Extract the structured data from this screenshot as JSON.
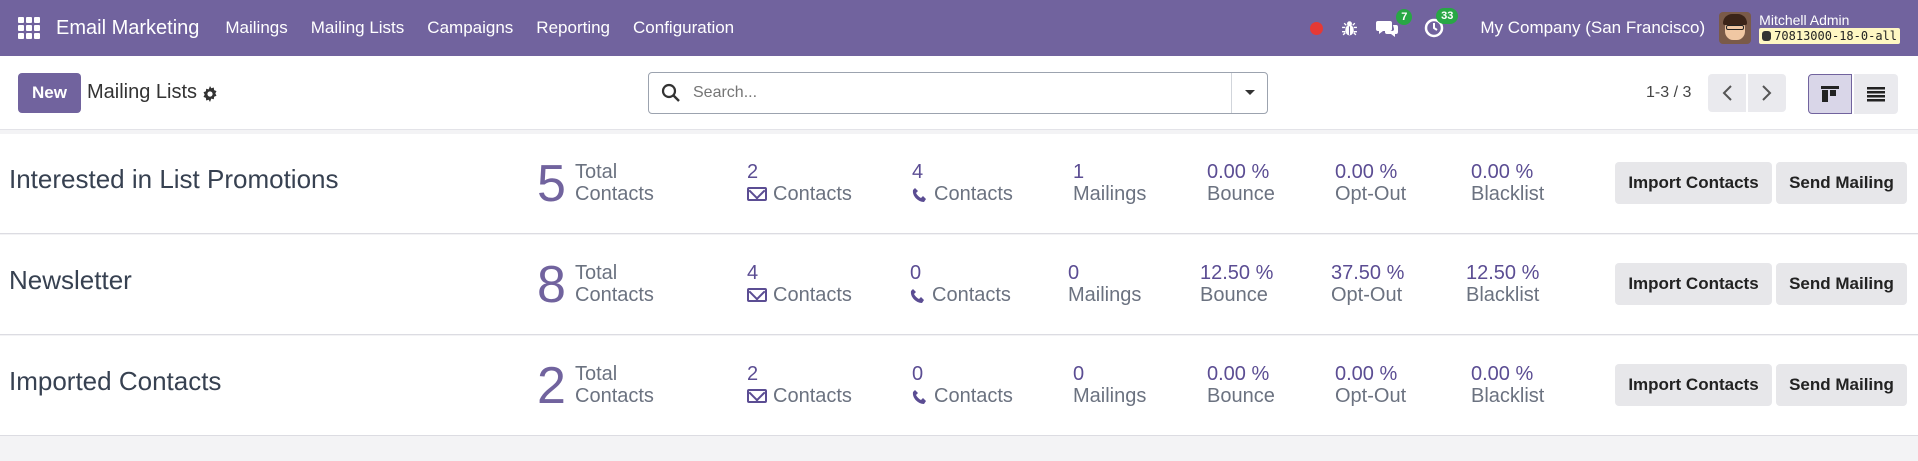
{
  "navbar": {
    "app_name": "Email Marketing",
    "menu": [
      "Mailings",
      "Mailing Lists",
      "Campaigns",
      "Reporting",
      "Configuration"
    ],
    "messages_count": "7",
    "activities_count": "33",
    "company": "My Company (San Francisco)",
    "user_name": "Mitchell Admin",
    "db_name": "70813000-18-0-all",
    "accent_color": "#71639e"
  },
  "control": {
    "new_label": "New",
    "breadcrumb": "Mailing Lists",
    "search_placeholder": "Search...",
    "pager": "1-3 / 3"
  },
  "records": [
    {
      "name": "Interested in List Promotions",
      "total": "5",
      "total_label_1": "Total",
      "total_label_2": "Contacts",
      "email_contacts": "2",
      "email_label": "Contacts",
      "phone_contacts": "4",
      "phone_label": "Contacts",
      "mailings": "1",
      "mailings_label": "Mailings",
      "bounce": "0.00 %",
      "bounce_label": "Bounce",
      "optout": "0.00 %",
      "optout_label": "Opt-Out",
      "blacklist": "0.00 %",
      "blacklist_label": "Blacklist",
      "import_label": "Import Contacts",
      "send_label": "Send Mailing"
    },
    {
      "name": "Newsletter",
      "total": "8",
      "total_label_1": "Total",
      "total_label_2": "Contacts",
      "email_contacts": "4",
      "email_label": "Contacts",
      "phone_contacts": "0",
      "phone_label": "Contacts",
      "mailings": "0",
      "mailings_label": "Mailings",
      "bounce": "12.50 %",
      "bounce_label": "Bounce",
      "optout": "37.50 %",
      "optout_label": "Opt-Out",
      "blacklist": "12.50 %",
      "blacklist_label": "Blacklist",
      "import_label": "Import Contacts",
      "send_label": "Send Mailing"
    },
    {
      "name": "Imported Contacts",
      "total": "2",
      "total_label_1": "Total",
      "total_label_2": "Contacts",
      "email_contacts": "2",
      "email_label": "Contacts",
      "phone_contacts": "0",
      "phone_label": "Contacts",
      "mailings": "0",
      "mailings_label": "Mailings",
      "bounce": "0.00 %",
      "bounce_label": "Bounce",
      "optout": "0.00 %",
      "optout_label": "Opt-Out",
      "blacklist": "0.00 %",
      "blacklist_label": "Blacklist",
      "import_label": "Import Contacts",
      "send_label": "Send Mailing"
    }
  ]
}
